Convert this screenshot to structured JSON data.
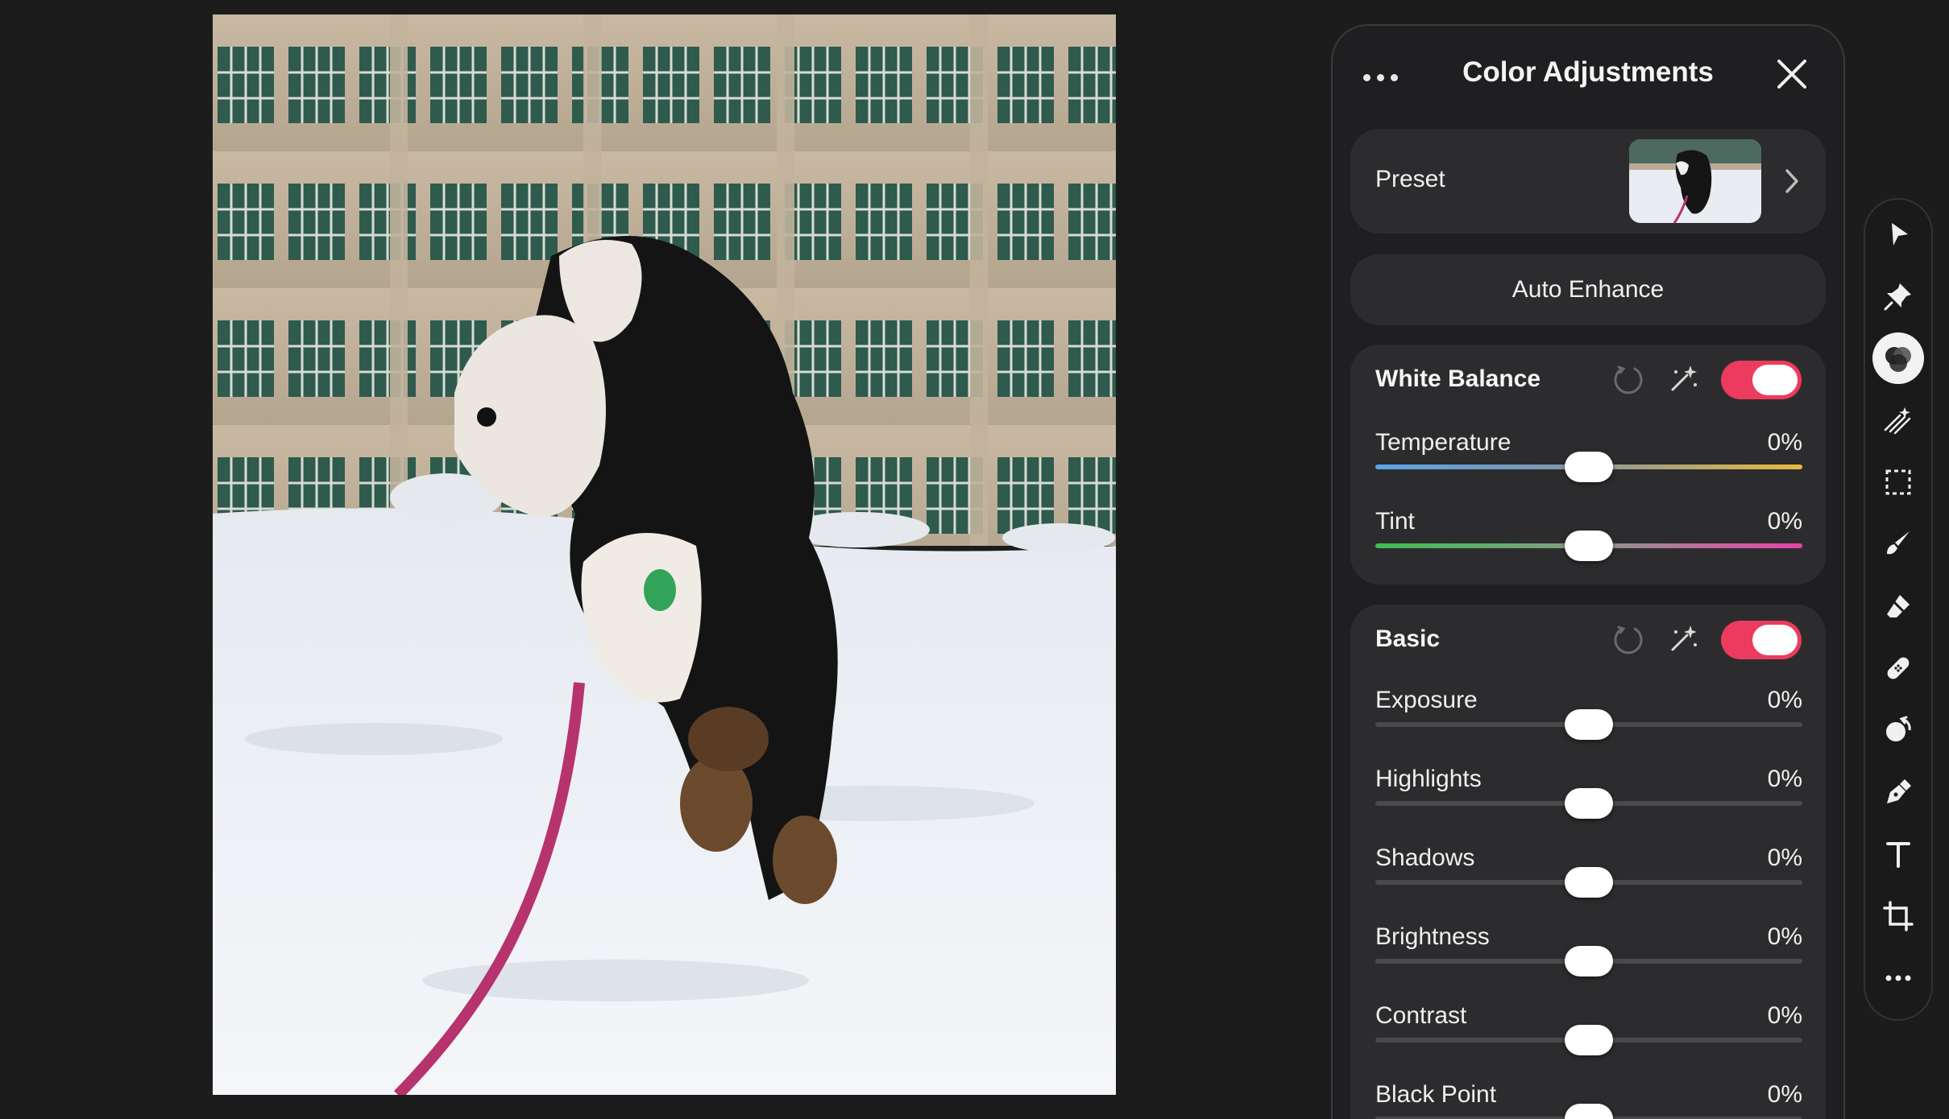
{
  "panel": {
    "title": "Color Adjustments",
    "more_icon": "ellipsis-icon",
    "close_icon": "close-icon",
    "preset": {
      "label": "Preset"
    },
    "auto_enhance": "Auto Enhance",
    "white_balance": {
      "title": "White Balance",
      "enabled": true,
      "rows": [
        {
          "label": "Temperature",
          "value": "0%",
          "level": 0.5
        },
        {
          "label": "Tint",
          "value": "0%",
          "level": 0.5
        }
      ]
    },
    "basic": {
      "title": "Basic",
      "enabled": true,
      "rows": [
        {
          "label": "Exposure",
          "value": "0%",
          "level": 0.5
        },
        {
          "label": "Highlights",
          "value": "0%",
          "level": 0.5
        },
        {
          "label": "Shadows",
          "value": "0%",
          "level": 0.5
        },
        {
          "label": "Brightness",
          "value": "0%",
          "level": 0.5
        },
        {
          "label": "Contrast",
          "value": "0%",
          "level": 0.5
        },
        {
          "label": "Black Point",
          "value": "0%",
          "level": 0.5
        }
      ]
    }
  },
  "toolbar": {
    "tools": [
      "arrow-select-icon",
      "pin-icon",
      "color-adjust-icon",
      "effects-icon",
      "selection-icon",
      "brush-icon",
      "eraser-icon",
      "bandage-icon",
      "clone-icon",
      "pen-icon",
      "text-icon",
      "crop-icon",
      "more-icon"
    ],
    "active": "color-adjust-icon"
  },
  "colors": {
    "accent_toggle": "#ec3b5e",
    "background": "#1c1c1d",
    "panel": "#1f1f21",
    "card": "#2c2c2e"
  }
}
